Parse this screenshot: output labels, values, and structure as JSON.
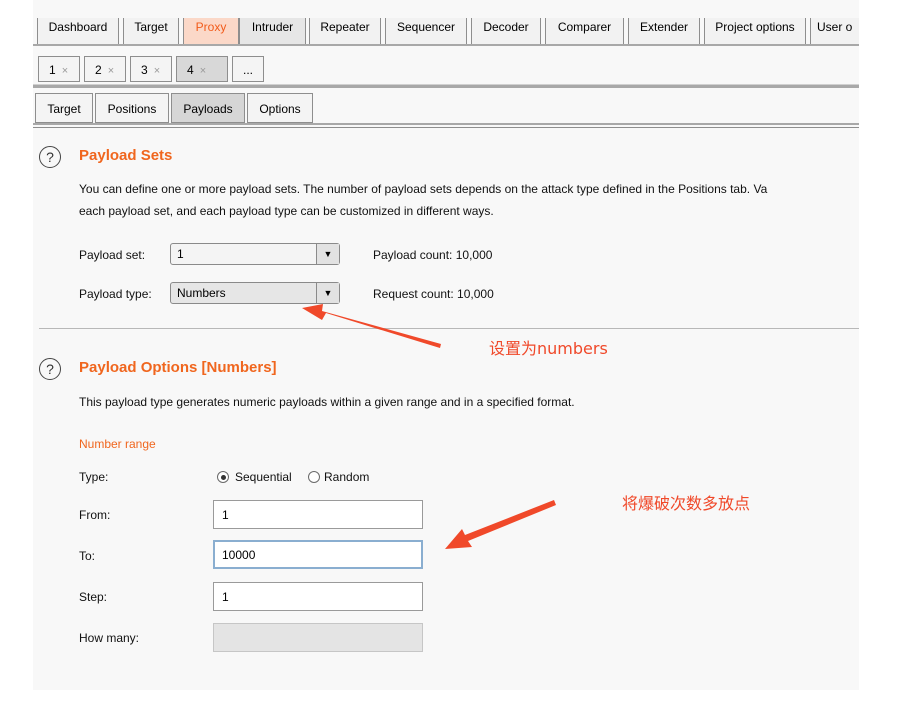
{
  "top_tabs": [
    "Dashboard",
    "Target",
    "Proxy",
    "Intruder",
    "Repeater",
    "Sequencer",
    "Decoder",
    "Comparer",
    "Extender",
    "Project options",
    "User o"
  ],
  "sub_tabs": [
    {
      "label": "1",
      "close": "×"
    },
    {
      "label": "2",
      "close": "×"
    },
    {
      "label": "3",
      "close": "×"
    },
    {
      "label": "4",
      "close": "×"
    }
  ],
  "sub_more": "...",
  "intruder_tabs": [
    "Target",
    "Positions",
    "Payloads",
    "Options"
  ],
  "help_glyph": "?",
  "payload_sets": {
    "title": "Payload Sets",
    "desc_line1": "You can define one or more payload sets. The number of payload sets depends on the attack type defined in the Positions tab. Va",
    "desc_line2": "each payload set, and each payload type can be customized in different ways.",
    "set_label": "Payload set:",
    "set_value": "1",
    "type_label": "Payload type:",
    "type_value": "Numbers",
    "payload_count": "Payload count:  10,000",
    "request_count": "Request count:  10,000"
  },
  "payload_options": {
    "title": "Payload Options [Numbers]",
    "desc": "This payload type generates numeric payloads within a given range and in a specified format.",
    "number_range": "Number range",
    "type_label": "Type:",
    "sequential": "Sequential",
    "random": "Random",
    "from_label": "From:",
    "from_value": "1",
    "to_label": "To:",
    "to_value": "10000",
    "step_label": "Step:",
    "step_value": "1",
    "howmany_label": "How many:"
  },
  "annotations": {
    "numbers_note": "设置为numbers",
    "range_note": "将爆破次数多放点"
  },
  "colors": {
    "accent": "#f0661e",
    "annotation": "#f0492a"
  }
}
